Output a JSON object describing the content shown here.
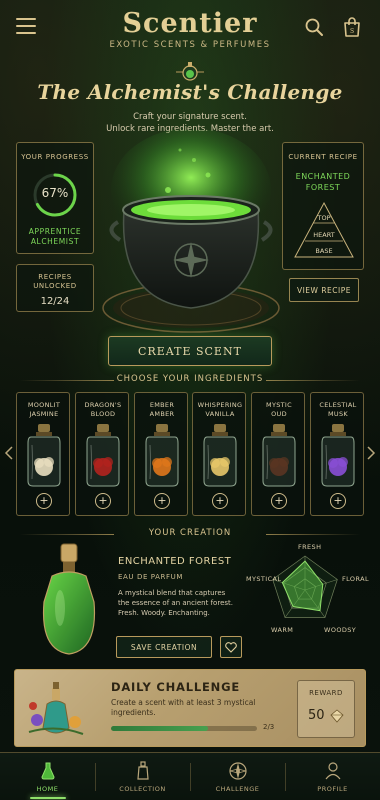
{
  "header": {
    "brand": "Scentier",
    "tagline": "EXOTIC SCENTS & PERFUMES"
  },
  "hero": {
    "title": "The Alchemist's Challenge",
    "subtitle_line1": "Craft your signature scent.",
    "subtitle_line2": "Unlock rare ingredients. Master the art."
  },
  "progress": {
    "label": "YOUR PROGRESS",
    "percent_text": "67%",
    "percent": 67,
    "rank_line1": "APPRENTICE",
    "rank_line2": "ALCHEMIST",
    "unlocked_label_line1": "RECIPES",
    "unlocked_label_line2": "UNLOCKED",
    "unlocked_value": "12/24"
  },
  "recipe": {
    "label": "CURRENT RECIPE",
    "name_line1": "ENCHANTED",
    "name_line2": "FOREST",
    "notes": [
      "TOP",
      "HEART",
      "BASE"
    ],
    "view_button": "VIEW RECIPE"
  },
  "create_button": "CREATE SCENT",
  "ingredients": {
    "heading": "CHOOSE YOUR INGREDIENTS",
    "items": [
      {
        "line1": "MOONLIT",
        "line2": "JASMINE",
        "color": "#e9dfbf"
      },
      {
        "line1": "DRAGON'S",
        "line2": "BLOOD",
        "color": "#b3231e"
      },
      {
        "line1": "EMBER",
        "line2": "AMBER",
        "color": "#e0771b"
      },
      {
        "line1": "WHISPERING",
        "line2": "VANILLA",
        "color": "#e8c869"
      },
      {
        "line1": "MYSTIC",
        "line2": "OUD",
        "color": "#5a3522"
      },
      {
        "line1": "CELESTIAL",
        "line2": "MUSK",
        "color": "#8a4fd6"
      }
    ],
    "add_symbol": "+"
  },
  "creation": {
    "heading": "YOUR CREATION",
    "name": "ENCHANTED FOREST",
    "type": "EAU DE PARFUM",
    "desc_line1": "A mystical blend that captures",
    "desc_line2": "the essence of an ancient forest.",
    "desc_line3": "Fresh. Woody. Enchanting.",
    "save_button": "SAVE CREATION",
    "radar_labels": {
      "fresh": "FRESH",
      "floral": "FLORAL",
      "woody": "WOODSY",
      "warm": "WARM",
      "mystical": "MYSTICAL"
    },
    "radar_values": {
      "fresh": 0.85,
      "floral": 0.55,
      "woody": 0.75,
      "warm": 0.6,
      "mystical": 0.7
    }
  },
  "challenge": {
    "title": "DAILY CHALLENGE",
    "desc_line1": "Create a scent with at least 3 mystical",
    "desc_line2": "ingredients.",
    "progress_text": "2/3",
    "progress": 0.6667,
    "reward_label": "REWARD",
    "reward_value": "50"
  },
  "nav": [
    {
      "label": "HOME",
      "icon": "flask-icon",
      "active": true
    },
    {
      "label": "COLLECTION",
      "icon": "bottle-icon",
      "active": false
    },
    {
      "label": "CHALLENGE",
      "icon": "compass-icon",
      "active": false
    },
    {
      "label": "PROFILE",
      "icon": "user-icon",
      "active": false
    }
  ],
  "colors": {
    "accent_green": "#7ed85a",
    "gold": "#d8c48f",
    "background": "#0b130d"
  }
}
